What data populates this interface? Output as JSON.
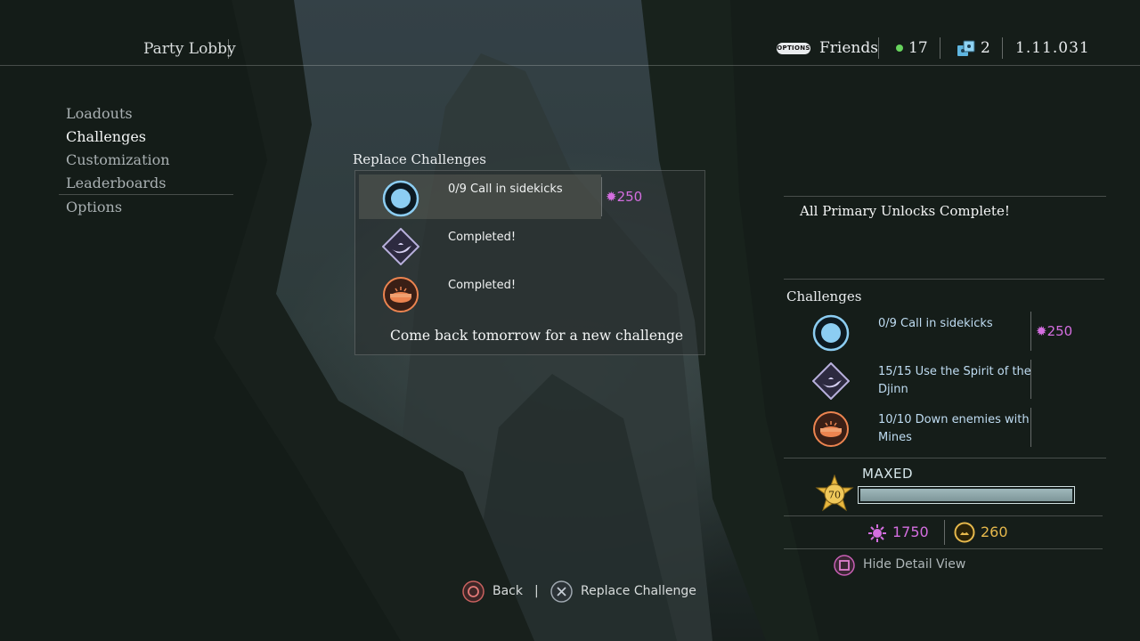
{
  "header": {
    "title": "Party Lobby",
    "options_button": "OPTIONS",
    "friends_label": "Friends",
    "online_count": "17",
    "party_count": "2",
    "version": "1.11.031"
  },
  "nav": {
    "items": [
      {
        "label": "Loadouts",
        "active": false
      },
      {
        "label": "Challenges",
        "active": true
      },
      {
        "label": "Customization",
        "active": false
      },
      {
        "label": "Leaderboards",
        "active": false
      },
      {
        "label": "Options",
        "active": false
      }
    ]
  },
  "replace_panel": {
    "title": "Replace Challenges",
    "challenges": [
      {
        "text": "0/9 Call in sidekicks",
        "reward": "250",
        "icon": "sidekick-circle-icon"
      },
      {
        "text": "Completed!",
        "icon": "djinn-lamp-icon"
      },
      {
        "text": "Completed!",
        "icon": "mine-icon"
      }
    ],
    "footer": "Come back tomorrow for a new challenge"
  },
  "detail": {
    "unlocks": "All Primary Unlocks Complete!",
    "challenges_heading": "Challenges",
    "challenges": [
      {
        "text": "0/9 Call in sidekicks",
        "reward": "250",
        "icon": "sidekick-circle-icon"
      },
      {
        "text_line1": "15/15 Use the Spirit of the",
        "text_line2": "Djinn",
        "icon": "djinn-lamp-icon"
      },
      {
        "text_line1": "10/10 Down enemies with",
        "text_line2": "Mines",
        "icon": "mine-icon"
      }
    ],
    "rank": "70",
    "rank_status": "MAXED",
    "xp_progress": 1.0,
    "relics": "1750",
    "coins": "260",
    "hide_detail": "Hide Detail View"
  },
  "bottom_bar": {
    "back_label": "Back",
    "separator": "|",
    "replace_label": "Replace Challenge"
  },
  "colors": {
    "accent_purple": "#d46ee0",
    "accent_blue": "#8ccdf2",
    "accent_orange": "#ec8450",
    "accent_gold": "#e6b84c",
    "online_green": "#67d45d"
  }
}
